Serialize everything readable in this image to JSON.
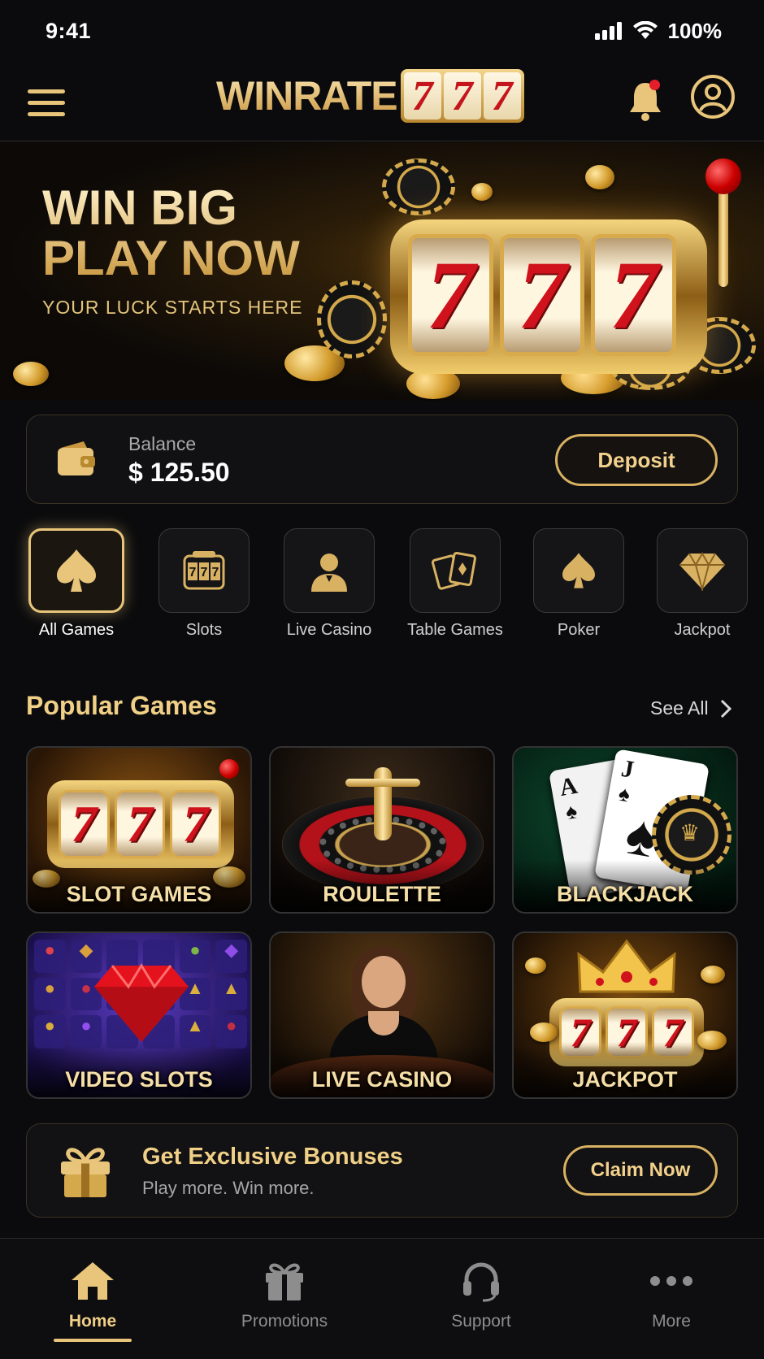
{
  "status": {
    "time": "9:41",
    "battery": "100%"
  },
  "header": {
    "logo_text": "WINRATE",
    "logo_digits": [
      "7",
      "7",
      "7"
    ]
  },
  "hero": {
    "title_line1": "WIN BIG",
    "title_line2": "PLAY NOW",
    "subtitle": "YOUR LUCK STARTS HERE",
    "reels": [
      "7",
      "7",
      "7"
    ]
  },
  "balance": {
    "label": "Balance",
    "value": "$ 125.50",
    "deposit_label": "Deposit"
  },
  "categories": [
    {
      "label": "All Games",
      "icon": "spade-icon",
      "active": true
    },
    {
      "label": "Slots",
      "icon": "slot-machine-icon"
    },
    {
      "label": "Live Casino",
      "icon": "dealer-icon"
    },
    {
      "label": "Table Games",
      "icon": "cards-icon"
    },
    {
      "label": "Poker",
      "icon": "spade-icon"
    },
    {
      "label": "Jackpot",
      "icon": "diamond-icon"
    }
  ],
  "popular": {
    "title": "Popular Games",
    "see_all": "See All",
    "games": [
      {
        "label": "SLOT GAMES"
      },
      {
        "label": "ROULETTE"
      },
      {
        "label": "BLACKJACK"
      },
      {
        "label": "VIDEO SLOTS"
      },
      {
        "label": "LIVE CASINO"
      },
      {
        "label": "JACKPOT"
      }
    ]
  },
  "bonus": {
    "title": "Get Exclusive Bonuses",
    "subtitle": "Play more. Win more.",
    "button": "Claim Now"
  },
  "nav": {
    "items": [
      {
        "label": "Home",
        "icon": "home-icon",
        "active": true
      },
      {
        "label": "Promotions",
        "icon": "gift-icon"
      },
      {
        "label": "Support",
        "icon": "headset-icon"
      },
      {
        "label": "More",
        "icon": "more-icon"
      }
    ]
  },
  "colors": {
    "gold": "#e8c57a",
    "background": "#0b0b0d",
    "red": "#d0121c"
  }
}
